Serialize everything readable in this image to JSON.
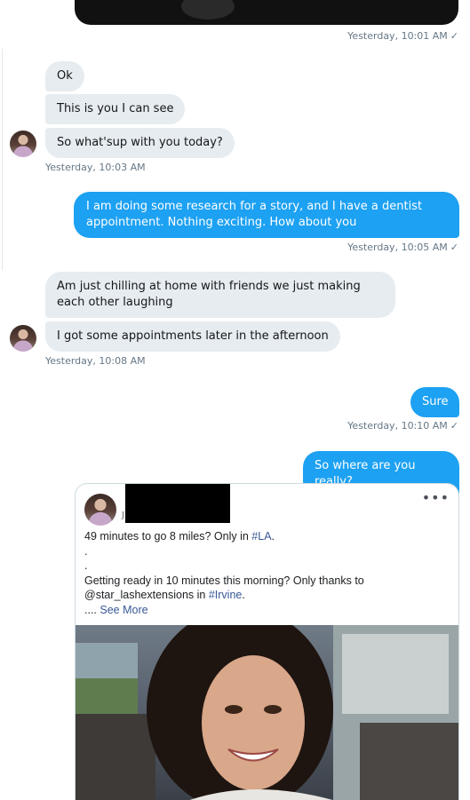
{
  "thread": {
    "media_timestamp": "Yesterday, 10:01 AM",
    "group1": {
      "messages": [
        "Ok",
        "This is you I can see",
        "So what'sup with you today?"
      ],
      "timestamp": "Yesterday, 10:03 AM"
    },
    "out1": {
      "text": "I am doing some research for a story, and I have a dentist appointment. Nothing exciting. How about you",
      "timestamp": "Yesterday, 10:05 AM"
    },
    "group2": {
      "messages": [
        "Am just chilling at home with friends we just making each other laughing",
        "I got some appointments later in the afternoon"
      ],
      "timestamp": "Yesterday, 10:08 AM"
    },
    "out2": {
      "text": "Sure",
      "timestamp": "Yesterday, 10:10 AM"
    },
    "out3": {
      "text": "So where are you really?"
    },
    "check_glyph": "✓"
  },
  "embedded_post": {
    "partial_name_char": "J",
    "more_glyph": "•••",
    "line1_text": "49 minutes to go 8 miles? Only in ",
    "line1_hashtag": "#LA",
    "line1_end": ".",
    "dot1": ".",
    "dot2": ".",
    "line4": "Getting ready in 10 minutes this morning? Only thanks to",
    "line5_text": "@star_lashextensions in ",
    "line5_hashtag": "#Irvine",
    "line5_end": ".",
    "see_more_prefix": ".... ",
    "see_more": "See More"
  },
  "colors": {
    "outgoing_bubble": "#1da1f2",
    "incoming_bubble": "#e6ecf0",
    "timestamp": "#657786",
    "hashtag": "#385898"
  }
}
